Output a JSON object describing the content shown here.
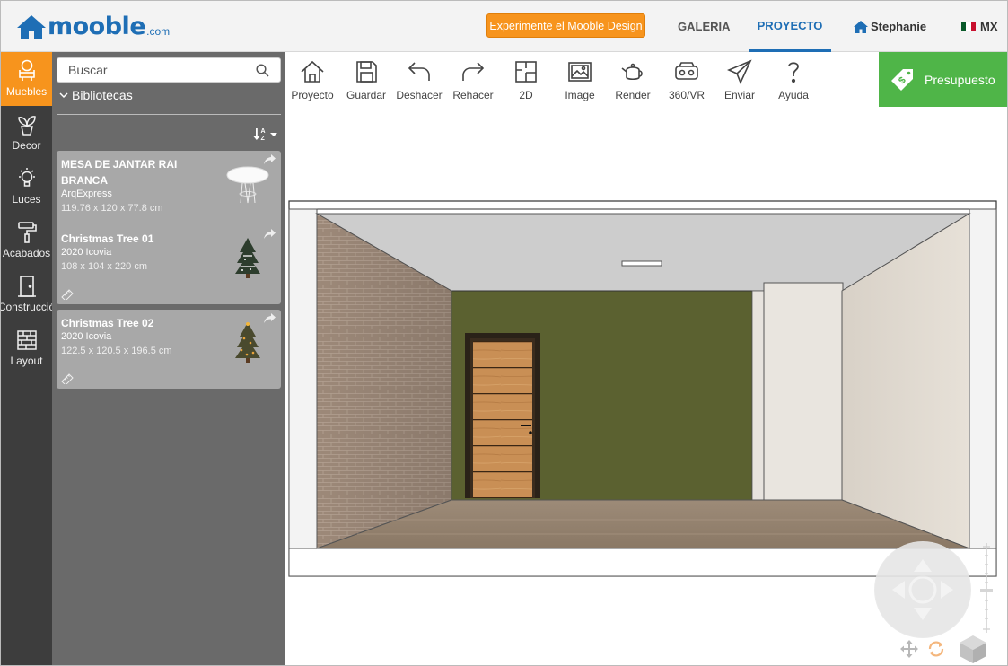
{
  "brand": {
    "logo_text": "mooble",
    "logo_domain": ".com"
  },
  "header": {
    "promo_button": "Experimente el Mooble Design",
    "nav": {
      "galeria": "GALERIA",
      "proyecto": "PROYECTO"
    },
    "user_name": "Stephanie",
    "country": "MX"
  },
  "rail": {
    "items": [
      {
        "label": "Muebles",
        "icon": "armchair-icon",
        "active": true
      },
      {
        "label": "Decor",
        "icon": "plant-icon"
      },
      {
        "label": "Luces",
        "icon": "lightbulb-icon"
      },
      {
        "label": "Acabados",
        "icon": "paint-roller-icon"
      },
      {
        "label": "Construcció",
        "icon": "door-icon"
      },
      {
        "label": "Layout",
        "icon": "brick-wall-icon"
      }
    ]
  },
  "library": {
    "search_placeholder": "Buscar",
    "section_label": "Bibliotecas",
    "items": [
      {
        "name": "MESA DE JANTAR RAI BRANCA",
        "brand": "ArqExpress",
        "dims": "119.76 x 120 x 77.8 cm"
      },
      {
        "name": "Christmas Tree 01",
        "brand": "2020 Icovia",
        "dims": "108 x 104 x 220 cm"
      },
      {
        "name": "Christmas Tree 02",
        "brand": "2020 Icovia",
        "dims": "122.5 x 120.5 x 196.5 cm"
      }
    ]
  },
  "toolbar": {
    "proyecto": "Proyecto",
    "guardar": "Guardar",
    "deshacer": "Deshacer",
    "rehacer": "Rehacer",
    "plan_2d": "2D",
    "image": "Image",
    "render": "Render",
    "vr": "360/VR",
    "enviar": "Enviar",
    "ayuda": "Ayuda",
    "presupuesto": "Presupuesto"
  },
  "colors": {
    "brand_blue": "#1e6eb5",
    "accent_orange": "#f7941d",
    "budget_green": "#4fb548",
    "rail_bg": "#3d3d3d",
    "panel_bg": "#6a6a6a",
    "wall_green": "#5b6130"
  }
}
